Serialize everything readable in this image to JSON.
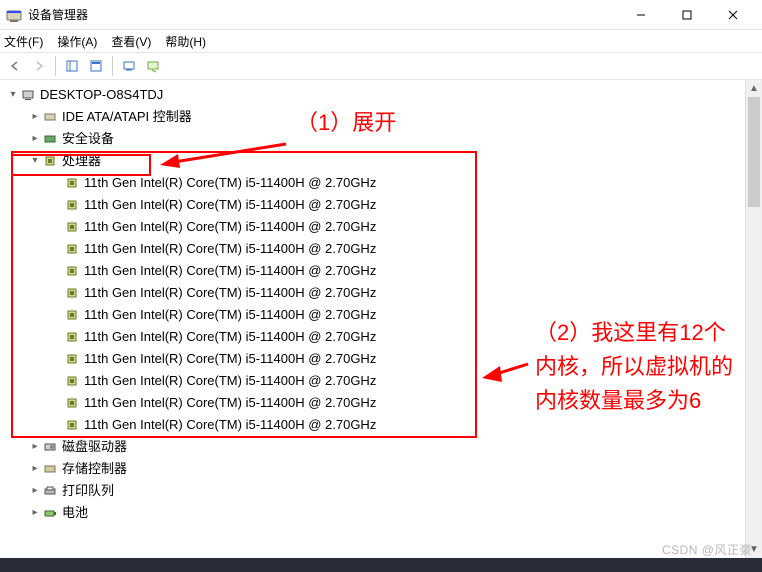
{
  "window": {
    "title": "设备管理器"
  },
  "menu": {
    "file": "文件(F)",
    "action": "操作(A)",
    "view": "查看(V)",
    "help": "帮助(H)"
  },
  "tree": {
    "root": "DESKTOP-O8S4TDJ",
    "ide": "IDE ATA/ATAPI 控制器",
    "security": "安全设备",
    "cpu_group": "处理器",
    "cpu_name": "11th Gen Intel(R) Core(TM) i5-11400H @ 2.70GHz",
    "disk": "磁盘驱动器",
    "storage": "存储控制器",
    "print": "打印队列",
    "battery": "电池"
  },
  "cpu_count": 12,
  "annotations": {
    "a1": "（1）展开",
    "a2": "（2）我这里有12个内核，所以虚拟机的内核数量最多为6"
  },
  "watermark": "CSDN @风正豪"
}
